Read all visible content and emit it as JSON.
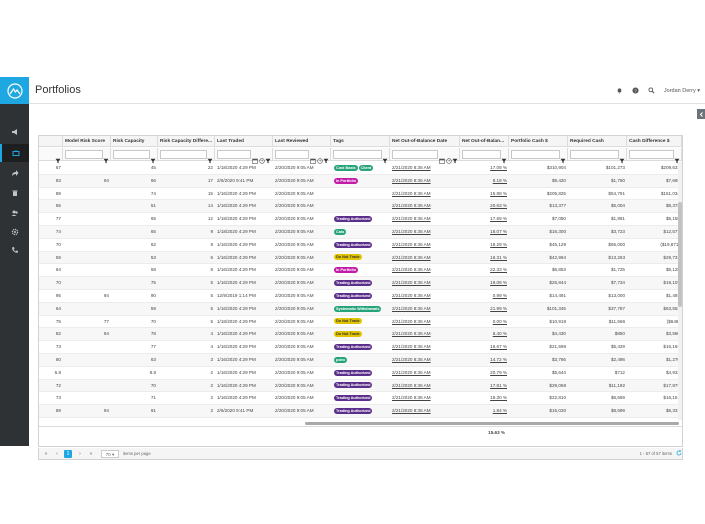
{
  "page": {
    "title": "Portfolios"
  },
  "user": {
    "name": "Jordan Derry ▾"
  },
  "columns": [
    "",
    "Model Risk Score",
    "Risk Capacity",
    "Risk Capacity Differe...",
    "Last Traded",
    "Last Reviewed",
    "Tags",
    "Net Out-of-Balance Date",
    "Net Out-of-Balan...",
    "Portfolio Cash $",
    "Required Cash",
    "Cash Difference $"
  ],
  "tag_colors": {
    "Cost Basis": "#26a37a",
    "Client": "#26a37a",
    "In Portfolio": "#c21ba8",
    "Trading Authorized": "#5a2e8a",
    "Cats": "#26a37a",
    "Do Not Trade": "#e0c400",
    "Systematic Withdrawals": "#26a37a",
    "pdeo": "#26a37a"
  },
  "rows": [
    {
      "c0": "67",
      "c1": "",
      "c2": "45",
      "c3": "22",
      "c4": "1/18/2020 4:29 PM",
      "c5": "2/20/2020 9:05 AM",
      "tags": [
        "Cost Basis",
        "Client"
      ],
      "c7": "2/21/2020 8:36 AM",
      "c8": "17.08 %",
      "c9": "$310,904",
      "c10": "$101,273",
      "c11": "$209,631"
    },
    {
      "c0": "83",
      "c1": "94",
      "c2": "66",
      "c3": "17",
      "c4": "2/6/2020 9:41 PM",
      "c5": "2/20/2020 9:05 AM",
      "tags": [
        "In Portfolio"
      ],
      "c7": "2/21/2020 8:36 AM",
      "c8": "8.18 %",
      "c9": "$9,420",
      "c10": "$1,750",
      "c11": "$7,669"
    },
    {
      "c0": "89",
      "c1": "",
      "c2": "74",
      "c3": "15",
      "c4": "1/16/2020 4:29 PM",
      "c5": "2/20/2020 9:05 AM",
      "tags": [],
      "c7": "2/21/2020 8:36 AM",
      "c8": "15.88 %",
      "c9": "$205,825",
      "c10": "$54,791",
      "c11": "$151,034"
    },
    {
      "c0": "65",
      "c1": "",
      "c2": "51",
      "c3": "14",
      "c4": "1/16/2020 4:29 PM",
      "c5": "2/20/2020 9:05 AM",
      "tags": [],
      "c7": "2/21/2020 8:36 AM",
      "c8": "20.63 %",
      "c9": "$13,377",
      "c10": "$5,004",
      "c11": "$8,373"
    },
    {
      "c0": "77",
      "c1": "",
      "c2": "65",
      "c3": "12",
      "c4": "1/18/2020 4:29 PM",
      "c5": "2/20/2020 9:05 AM",
      "tags": [
        "Trading Authorized"
      ],
      "c7": "2/21/2020 8:36 AM",
      "c8": "17.69 %",
      "c9": "$7,050",
      "c10": "$1,891",
      "c11": "$5,158"
    },
    {
      "c0": "74",
      "c1": "",
      "c2": "65",
      "c3": "9",
      "c4": "1/18/2020 4:29 PM",
      "c5": "2/20/2020 9:05 AM",
      "tags": [
        "Cats"
      ],
      "c7": "2/21/2020 8:36 AM",
      "c8": "18.07 %",
      "c9": "$16,300",
      "c10": "$3,723",
      "c11": "$12,577"
    },
    {
      "c0": "70",
      "c1": "",
      "c2": "62",
      "c3": "8",
      "c4": "1/16/2020 4:29 PM",
      "c5": "2/20/2020 9:05 AM",
      "tags": [
        "Trading Authorized"
      ],
      "c7": "2/21/2020 8:36 AM",
      "c8": "18.29 %",
      "c9": "$45,129",
      "c10": "$65,000",
      "c11": "($19,871)"
    },
    {
      "c0": "59",
      "c1": "",
      "c2": "53",
      "c3": "6",
      "c4": "1/16/2020 4:29 PM",
      "c5": "2/20/2020 9:05 AM",
      "tags": [
        "Do Not Trade"
      ],
      "c7": "2/21/2020 8:36 AM",
      "c8": "16.31 %",
      "c9": "$42,994",
      "c10": "$13,263",
      "c11": "$29,731"
    },
    {
      "c0": "64",
      "c1": "",
      "c2": "58",
      "c3": "6",
      "c4": "1/16/2020 4:29 PM",
      "c5": "2/20/2020 9:05 AM",
      "tags": [
        "In Portfolio"
      ],
      "c7": "2/21/2020 8:36 AM",
      "c8": "22.33 %",
      "c9": "$6,853",
      "c10": "$1,725",
      "c11": "$5,128"
    },
    {
      "c0": "70",
      "c1": "",
      "c2": "75",
      "c3": "5",
      "c4": "1/16/2020 4:29 PM",
      "c5": "2/20/2020 9:05 AM",
      "tags": [
        "Trading Authorized"
      ],
      "c7": "2/21/2020 8:36 AM",
      "c8": "19.08 %",
      "c9": "$26,844",
      "c10": "$7,734",
      "c11": "$19,109"
    },
    {
      "c0": "95",
      "c1": "94",
      "c2": "90",
      "c3": "5",
      "c4": "12/9/2019 1:14 PM",
      "c5": "2/20/2020 9:05 AM",
      "tags": [
        "Trading Authorized"
      ],
      "c7": "2/21/2020 8:36 AM",
      "c8": "0.99 %",
      "c9": "$14,491",
      "c10": "$13,000",
      "c11": "$1,491"
    },
    {
      "c0": "64",
      "c1": "",
      "c2": "59",
      "c3": "5",
      "c4": "1/16/2020 4:29 PM",
      "c5": "2/20/2020 9:05 AM",
      "tags": [
        "Systematic Withdrawals"
      ],
      "c7": "2/21/2020 8:36 AM",
      "c8": "21.99 %",
      "c9": "$101,345",
      "c10": "$37,787",
      "c11": "$63,558"
    },
    {
      "c0": "75",
      "c1": "77",
      "c2": "70",
      "c3": "5",
      "c4": "1/18/2020 4:29 PM",
      "c5": "2/20/2020 9:05 AM",
      "tags": [
        "Do Not Trade"
      ],
      "c7": "2/21/2020 8:36 AM",
      "c8": "0.00 %",
      "c9": "$10,918",
      "c10": "$11,566",
      "c11": "($648)"
    },
    {
      "c0": "82",
      "c1": "94",
      "c2": "78",
      "c3": "4",
      "c4": "1/16/2020 4:29 PM",
      "c5": "2/20/2020 9:05 AM",
      "tags": [
        "Do Not Trade"
      ],
      "c7": "2/21/2020 8:36 AM",
      "c8": "6.40 %",
      "c9": "$4,430",
      "c10": "$850",
      "c11": "$3,580"
    },
    {
      "c0": "73",
      "c1": "",
      "c2": "77",
      "c3": "4",
      "c4": "1/16/2020 4:29 PM",
      "c5": "2/20/2020 9:05 AM",
      "tags": [
        "Trading Authorized"
      ],
      "c7": "2/21/2020 8:36 AM",
      "c8": "16.67 %",
      "c9": "$21,598",
      "c10": "$5,429",
      "c11": "$16,169"
    },
    {
      "c0": "60",
      "c1": "",
      "c2": "63",
      "c3": "3",
      "c4": "1/16/2020 4:29 PM",
      "c5": "2/20/2020 9:05 AM",
      "tags": [
        "pdeo"
      ],
      "c7": "2/21/2020 8:36 AM",
      "c8": "14.72 %",
      "c9": "$3,766",
      "c10": "$2,496",
      "c11": "$1,270"
    },
    {
      "c0": "6.8",
      "c1": "",
      "c2": "8.8",
      "c3": "2",
      "c4": "1/16/2020 4:29 PM",
      "c5": "2/20/2020 9:05 AM",
      "tags": [
        "Trading Authorized"
      ],
      "c7": "2/21/2020 8:36 AM",
      "c8": "20.79 %",
      "c9": "$5,644",
      "c10": "$712",
      "c11": "$4,932"
    },
    {
      "c0": "72",
      "c1": "",
      "c2": "70",
      "c3": "2",
      "c4": "1/16/2020 4:29 PM",
      "c5": "2/20/2020 9:05 AM",
      "tags": [
        "Trading Authorized"
      ],
      "c7": "2/21/2020 8:36 AM",
      "c8": "17.81 %",
      "c9": "$29,068",
      "c10": "$11,192",
      "c11": "$17,875"
    },
    {
      "c0": "73",
      "c1": "",
      "c2": "71",
      "c3": "2",
      "c4": "1/16/2020 4:29 PM",
      "c5": "2/20/2020 9:05 AM",
      "tags": [
        "Trading Authorized"
      ],
      "c7": "2/21/2020 8:36 AM",
      "c8": "19.30 %",
      "c9": "$22,810",
      "c10": "$6,659",
      "c11": "$16,151"
    },
    {
      "c0": "89",
      "c1": "94",
      "c2": "91",
      "c3": "2",
      "c4": "2/6/2020 9:41 PM",
      "c5": "2/20/2020 9:05 AM",
      "tags": [
        "Trading Authorized"
      ],
      "c7": "2/21/2020 8:36 AM",
      "c8": "1.84 %",
      "c9": "$15,030",
      "c10": "$8,699",
      "c11": "$6,331"
    }
  ],
  "totals": {
    "net_out_of_balance": "15.63 %"
  },
  "pager": {
    "prev_first": "«",
    "prev": "‹",
    "page": "1",
    "next": "›",
    "last": "»",
    "page_size": "70 ▾",
    "items_per_page": "items per page",
    "range": "1 - 57 of 57 items"
  }
}
